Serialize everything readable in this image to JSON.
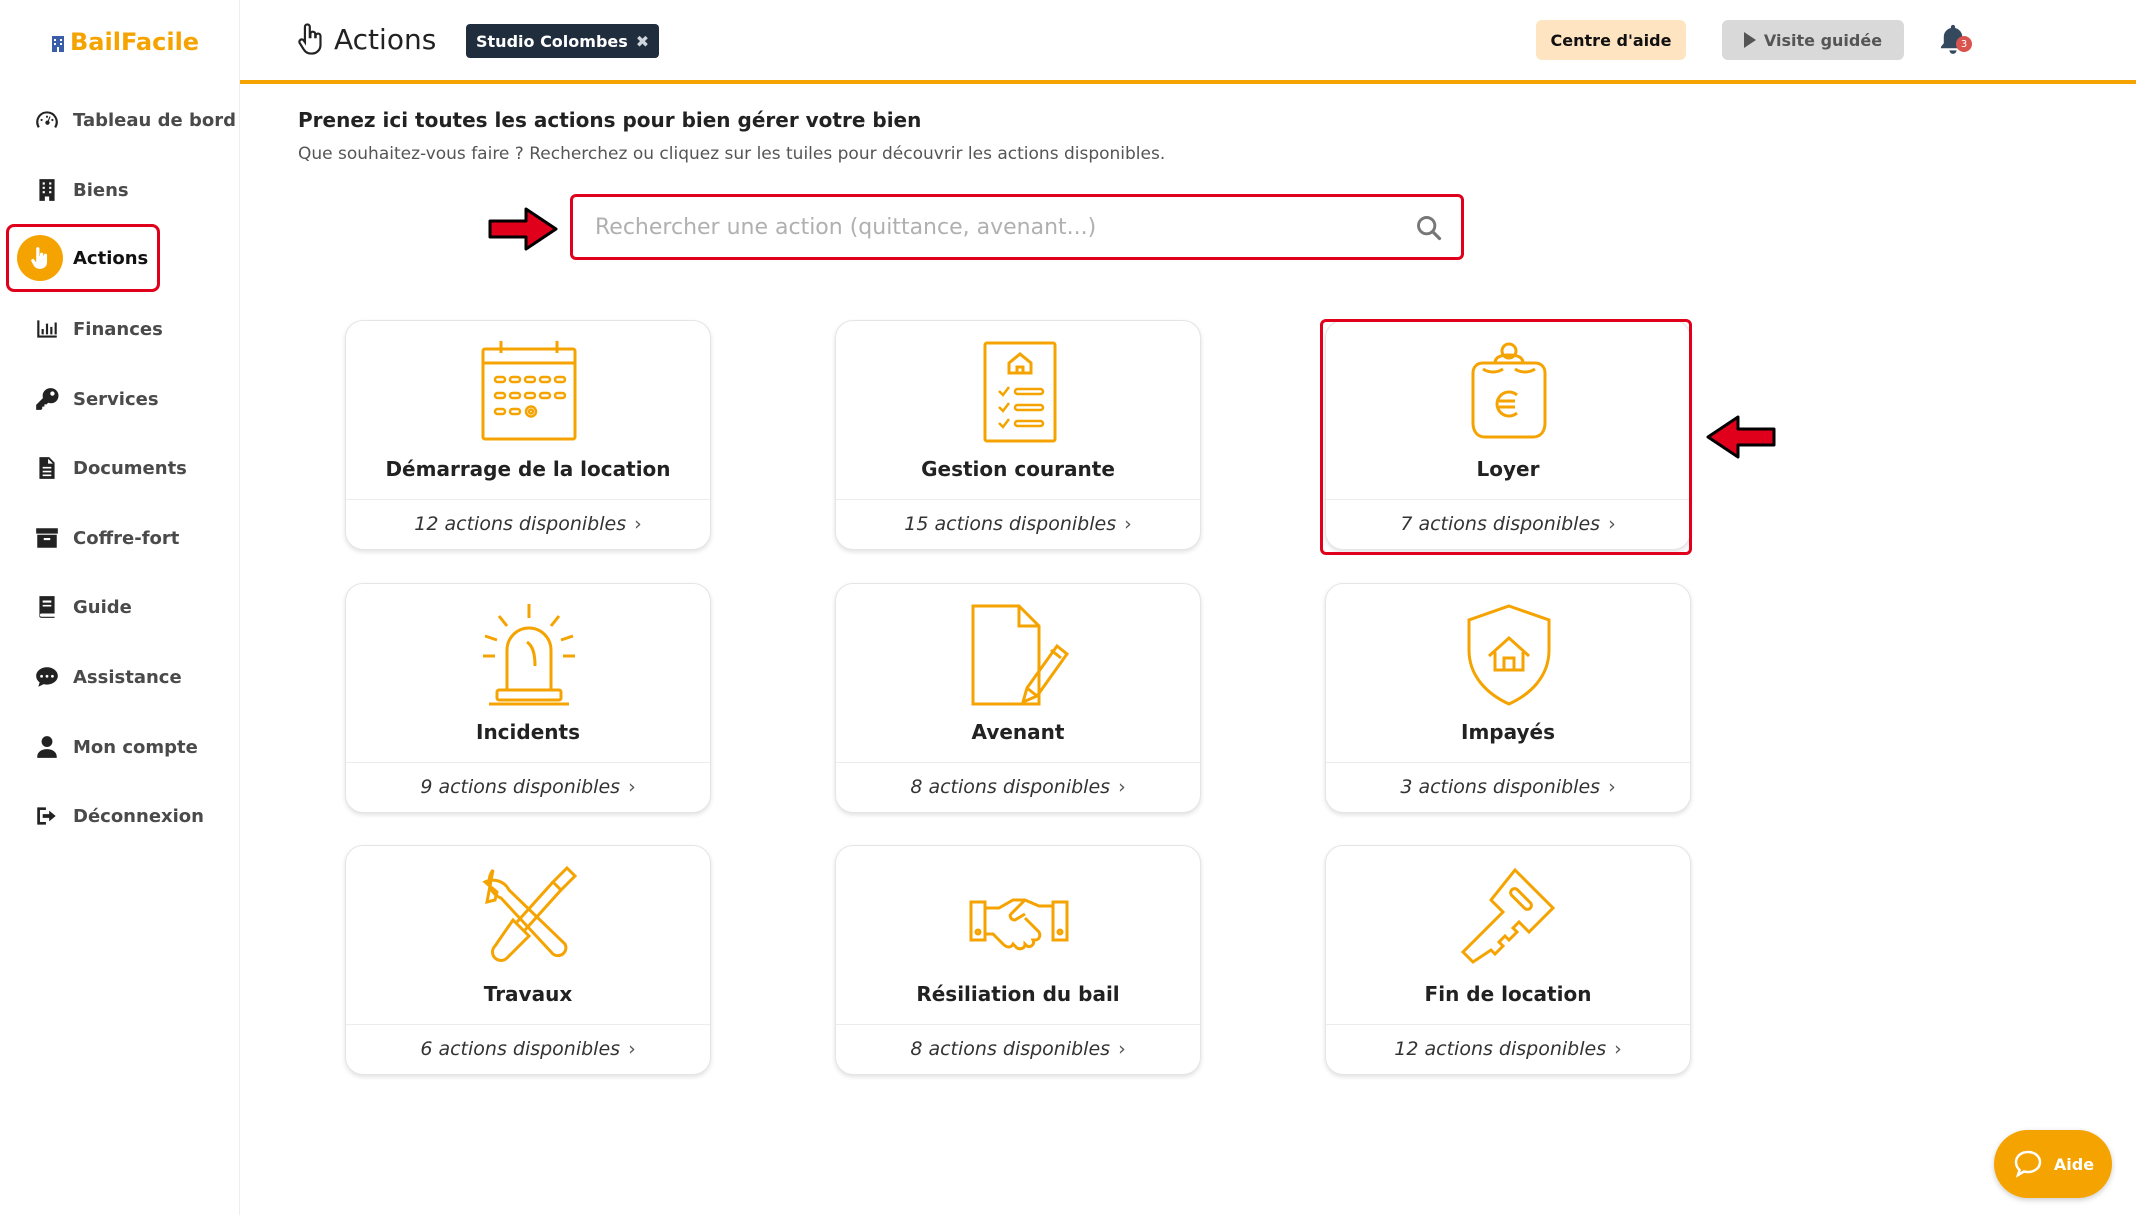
{
  "brand": {
    "name": "BailFacile"
  },
  "sidebar": {
    "items": [
      {
        "label": "Tableau de bord",
        "icon": "dashboard-gauge-icon"
      },
      {
        "label": "Biens",
        "icon": "building-icon"
      },
      {
        "label": "Actions",
        "icon": "hand-pointer-icon",
        "active": true
      },
      {
        "label": "Finances",
        "icon": "bar-chart-icon"
      },
      {
        "label": "Services",
        "icon": "key-icon"
      },
      {
        "label": "Documents",
        "icon": "document-icon"
      },
      {
        "label": "Coffre-fort",
        "icon": "archive-box-icon"
      },
      {
        "label": "Guide",
        "icon": "book-icon"
      },
      {
        "label": "Assistance",
        "icon": "chat-bubble-icon"
      },
      {
        "label": "Mon compte",
        "icon": "user-icon"
      },
      {
        "label": "Déconnexion",
        "icon": "sign-out-icon"
      }
    ]
  },
  "header": {
    "title": "Actions",
    "property_chip": "Studio Colombes",
    "property_chip_close": "✖",
    "help_center_label": "Centre d'aide",
    "guided_tour_label": "Visite guidée",
    "notifications_count": "3"
  },
  "main": {
    "intro_title": "Prenez ici toutes les actions pour bien gérer votre bien",
    "intro_subtitle": "Que souhaitez-vous faire ? Recherchez ou cliquez sur les tuiles pour découvrir les actions disponibles.",
    "search_placeholder": "Rechercher une action (quittance, avenant...)",
    "tiles": [
      {
        "name": "Démarrage de la location",
        "count": "12 actions disponibles",
        "icon": "calendar-icon"
      },
      {
        "name": "Gestion courante",
        "count": "15 actions disponibles",
        "icon": "checklist-icon"
      },
      {
        "name": "Loyer",
        "count": "7 actions disponibles",
        "icon": "euro-purse-icon",
        "highlighted": true
      },
      {
        "name": "Incidents",
        "count": "9 actions disponibles",
        "icon": "alarm-siren-icon"
      },
      {
        "name": "Avenant",
        "count": "8 actions disponibles",
        "icon": "document-pen-icon"
      },
      {
        "name": "Impayés",
        "count": "3 actions disponibles",
        "icon": "shield-house-icon"
      },
      {
        "name": "Travaux",
        "count": "6 actions disponibles",
        "icon": "wrench-screwdriver-icon"
      },
      {
        "name": "Résiliation du bail",
        "count": "8 actions disponibles",
        "icon": "handshake-icon"
      },
      {
        "name": "Fin de location",
        "count": "12 actions disponibles",
        "icon": "key-icon"
      }
    ]
  },
  "help_bubble": {
    "label": "Aide"
  },
  "colors": {
    "accent": "#F5A300",
    "highlight": "#E0001B",
    "chip_bg": "#1f2d3d"
  }
}
